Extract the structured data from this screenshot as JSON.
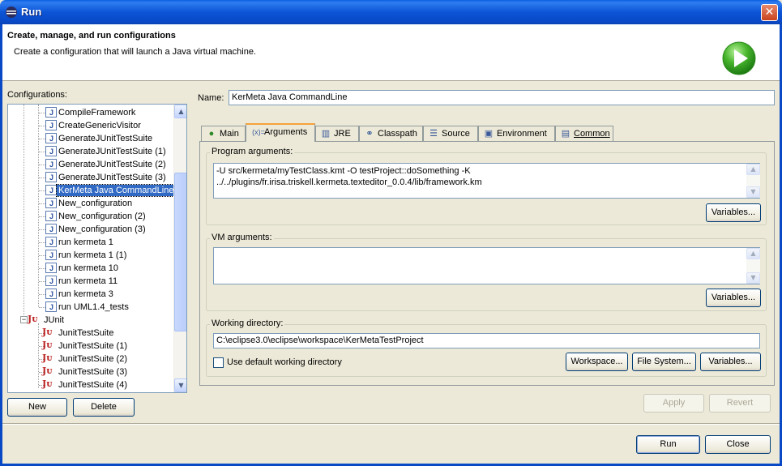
{
  "window": {
    "title": "Run",
    "close_glyph": "✕"
  },
  "header": {
    "title": "Create, manage, and run configurations",
    "description": "Create a configuration that will launch a Java virtual machine."
  },
  "configurations": {
    "label": "Configurations:",
    "java_items": [
      "CompileFramework",
      "CreateGenericVisitor",
      "GenerateJUnitTestSuite",
      "GenerateJUnitTestSuite (1)",
      "GenerateJUnitTestSuite (2)",
      "GenerateJUnitTestSuite (3)",
      "KerMeta Java CommandLine",
      "New_configuration",
      "New_configuration (2)",
      "New_configuration (3)",
      "run kermeta 1",
      "run kermeta 1 (1)",
      "run kermeta 10",
      "run kermeta 11",
      "run kermeta 3",
      "run UML1.4_tests"
    ],
    "selected": "KerMeta Java CommandLine",
    "junit_label": "JUnit",
    "junit_items": [
      "JunitTestSuite",
      "JunitTestSuite (1)",
      "JunitTestSuite (2)",
      "JunitTestSuite (3)",
      "JunitTestSuite (4)"
    ],
    "new_button": "New",
    "delete_button": "Delete"
  },
  "name": {
    "label": "Name:",
    "value": "KerMeta Java CommandLine"
  },
  "tabs": [
    {
      "label": "Main",
      "icon": "main-icon",
      "glyph": "●"
    },
    {
      "label": "Arguments",
      "icon": "arguments-icon",
      "glyph": "(x)="
    },
    {
      "label": "JRE",
      "icon": "jre-icon",
      "glyph": "▥"
    },
    {
      "label": "Classpath",
      "icon": "classpath-icon",
      "glyph": "⚭"
    },
    {
      "label": "Source",
      "icon": "source-icon",
      "glyph": "☰"
    },
    {
      "label": "Environment",
      "icon": "environment-icon",
      "glyph": "▣"
    },
    {
      "label": "Common",
      "icon": "common-icon",
      "glyph": "▤"
    }
  ],
  "arguments": {
    "program_label": "Program arguments:",
    "program_value": "-U src/kermeta/myTestClass.kmt -O testProject::doSomething -K\n../../plugins/fr.irisa.triskell.kermeta.texteditor_0.0.4/lib/framework.km",
    "variables_button": "Variables...",
    "vm_label": "VM arguments:",
    "vm_value": "",
    "working_dir_label": "Working directory:",
    "working_dir_value": "C:\\eclipse3.0\\eclipse\\workspace\\KerMetaTestProject",
    "use_default_label": "Use default working directory",
    "use_default_checked": false,
    "workspace_button": "Workspace...",
    "filesystem_button": "File System...",
    "apply_button": "Apply",
    "revert_button": "Revert"
  },
  "footer": {
    "run_button": "Run",
    "close_button": "Close"
  },
  "colors": {
    "titlebar": "#0a49c6",
    "selection": "#316ac5",
    "active_tab": "#f5a13a",
    "run_logo": "#3fae2a"
  }
}
